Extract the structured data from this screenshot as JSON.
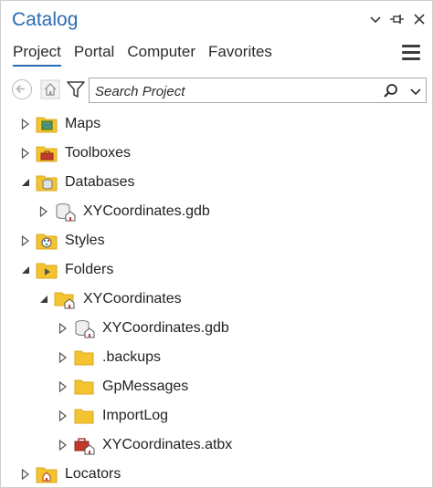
{
  "window": {
    "title": "Catalog",
    "controls": [
      "chevron-down-icon",
      "pin-icon",
      "close-icon"
    ]
  },
  "tabs": [
    {
      "label": "Project",
      "active": true
    },
    {
      "label": "Portal",
      "active": false
    },
    {
      "label": "Computer",
      "active": false
    },
    {
      "label": "Favorites",
      "active": false
    }
  ],
  "toolbar": {
    "search_placeholder": "Search Project"
  },
  "tree": [
    {
      "label": "Maps",
      "icon": "maps-folder-icon",
      "expanded": false
    },
    {
      "label": "Toolboxes",
      "icon": "toolboxes-folder-icon",
      "expanded": false
    },
    {
      "label": "Databases",
      "icon": "databases-folder-icon",
      "expanded": true
    },
    {
      "label": "XYCoordinates.gdb",
      "icon": "geodatabase-home-icon",
      "expanded": false
    },
    {
      "label": "Styles",
      "icon": "styles-folder-icon",
      "expanded": false
    },
    {
      "label": "Folders",
      "icon": "folders-folder-icon",
      "expanded": true
    },
    {
      "label": "XYCoordinates",
      "icon": "home-folder-icon",
      "expanded": true
    },
    {
      "label": "XYCoordinates.gdb",
      "icon": "geodatabase-home-icon",
      "expanded": false
    },
    {
      "label": ".backups",
      "icon": "folder-icon",
      "expanded": false
    },
    {
      "label": "GpMessages",
      "icon": "folder-icon",
      "expanded": false
    },
    {
      "label": "ImportLog",
      "icon": "folder-icon",
      "expanded": false
    },
    {
      "label": "XYCoordinates.atbx",
      "icon": "toolbox-home-icon",
      "expanded": false
    },
    {
      "label": "Locators",
      "icon": "locators-folder-icon",
      "expanded": false
    }
  ],
  "colors": {
    "accent": "#2a6ab3",
    "folder": "#f4c430",
    "folder_dark": "#d9a81e"
  }
}
